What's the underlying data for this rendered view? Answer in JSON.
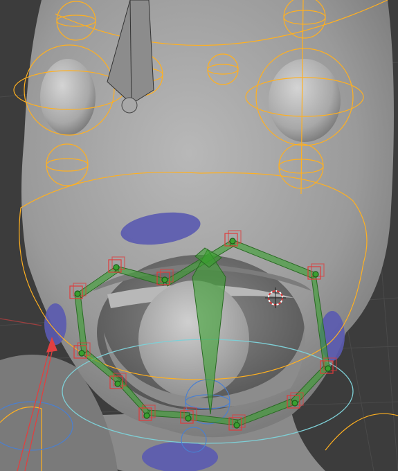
{
  "viewport": {
    "label": "3D Viewport",
    "background_color": "#3c3c3c",
    "grid_color": "#4a4a4a",
    "mesh_color": "#9a9a9a",
    "mesh_highlight": "#c8c8c8",
    "mesh_shadow": "#5e5e5e"
  },
  "rig": {
    "deform_bone_color": "#ffb020",
    "control_bone_color": "#3aa030",
    "selected_handle_color": "#e03a3a",
    "weight_patch_color": "#5a5ab0",
    "lower_circle_color": "#7ecfd6",
    "jaw_circle_color": "#4a7fd0",
    "axis_color": "#e04040"
  },
  "overlays": {
    "cursor_icon": "3d-cursor-icon"
  }
}
